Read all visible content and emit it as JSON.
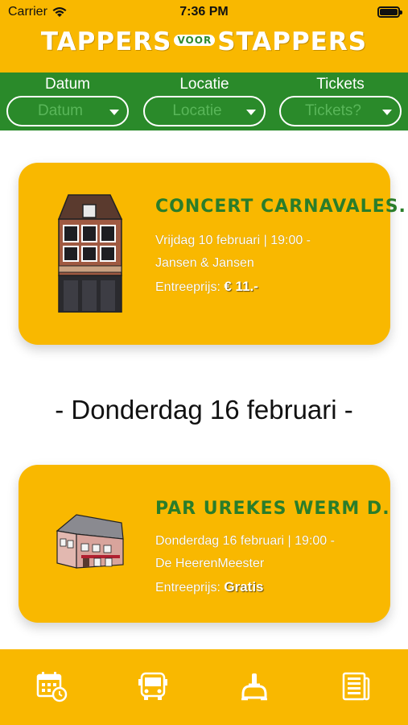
{
  "status_bar": {
    "carrier": "Carrier",
    "time": "7:36 PM"
  },
  "header": {
    "logo_left": "TAPPERS",
    "logo_mid": "VOOR",
    "logo_right": "STAPPERS"
  },
  "filters": [
    {
      "label": "Datum",
      "placeholder": "Datum"
    },
    {
      "label": "Locatie",
      "placeholder": "Locatie"
    },
    {
      "label": "Tickets",
      "placeholder": "Tickets?"
    }
  ],
  "events": [
    {
      "title": "CONCERT CARNAVALES.",
      "date_time": "Vrijdag 10 februari | 19:00 -",
      "venue": "Jansen & Jansen",
      "price_label": "Entreeprijs:",
      "price_value": "€ 11.-"
    },
    {
      "title": "PAR UREKES WERM D.",
      "date_time": "Donderdag 16 februari | 19:00 -",
      "venue": "De HeerenMeester",
      "price_label": "Entreeprijs:",
      "price_value": "Gratis"
    }
  ],
  "section_heading": "- Donderdag 16 februari -",
  "tabs": [
    {
      "icon": "calendar-icon"
    },
    {
      "icon": "bus-icon"
    },
    {
      "icon": "tap-icon"
    },
    {
      "icon": "newspaper-icon"
    }
  ],
  "colors": {
    "brand_yellow": "#f9b800",
    "brand_green": "#2a8a2a",
    "title_green": "#2a7d2a"
  }
}
